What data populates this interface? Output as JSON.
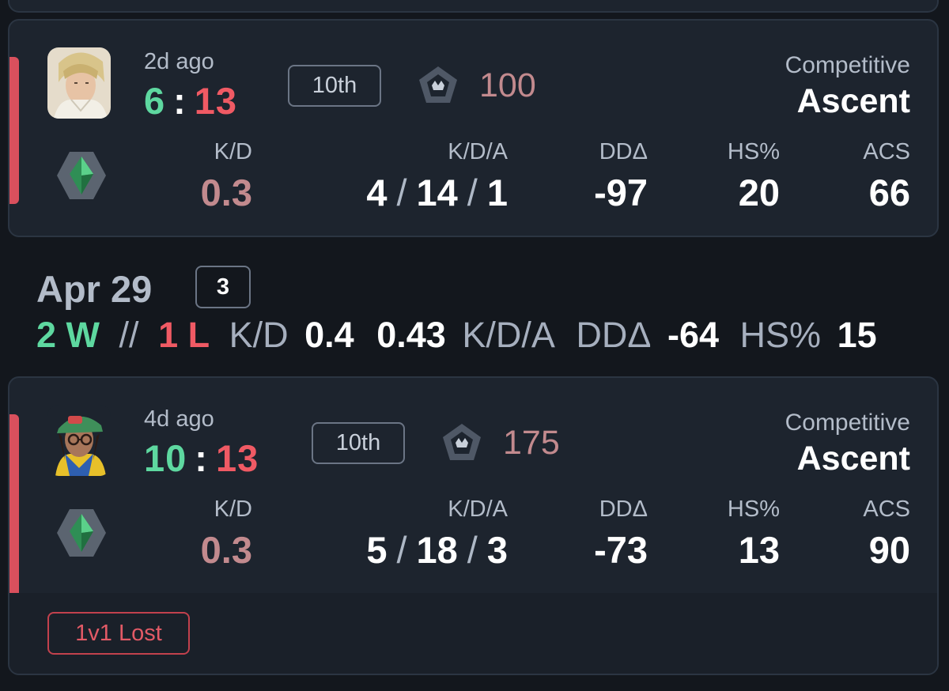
{
  "matches": [
    {
      "time_ago": "2d ago",
      "score_won": "6",
      "score_sep": ":",
      "score_lost": "13",
      "placement": "10th",
      "rank_rating": "100",
      "mode": "Competitive",
      "map": "Ascent",
      "result_color": "#d9505d",
      "stats": {
        "kd_label": "K/D",
        "kd_value": "0.3",
        "kda_label": "K/D/A",
        "kills": "4",
        "deaths": "14",
        "assists": "1",
        "dd_label": "DDΔ",
        "dd_value": "-97",
        "hs_label": "HS%",
        "hs_value": "20",
        "acs_label": "ACS",
        "acs_value": "66"
      }
    },
    {
      "time_ago": "4d ago",
      "score_won": "10",
      "score_sep": ":",
      "score_lost": "13",
      "placement": "10th",
      "rank_rating": "175",
      "mode": "Competitive",
      "map": "Ascent",
      "result_color": "#d9505d",
      "stats": {
        "kd_label": "K/D",
        "kd_value": "0.3",
        "kda_label": "K/D/A",
        "kills": "5",
        "deaths": "18",
        "assists": "3",
        "dd_label": "DDΔ",
        "dd_value": "-73",
        "hs_label": "HS%",
        "hs_value": "13",
        "acs_label": "ACS",
        "acs_value": "90"
      },
      "badge": "1v1 Lost"
    }
  ],
  "day": {
    "date": "Apr 29",
    "match_count": "3",
    "wins": "2 W",
    "divider": "//",
    "losses": "1 L",
    "kd_label": "K/D",
    "kd_value": "0.4",
    "kda_value": "0.43",
    "kda_label": "K/D/A",
    "dd_label": "DDΔ",
    "dd_value": "-64",
    "hs_label": "HS%",
    "hs_value": "15"
  },
  "icons": {
    "agent_1": "agent-portrait-blonde",
    "agent_2": "agent-portrait-green-cap",
    "rank": "rank-pentagon-icon",
    "tier_gem": "emerald-rank-gem-icon"
  }
}
